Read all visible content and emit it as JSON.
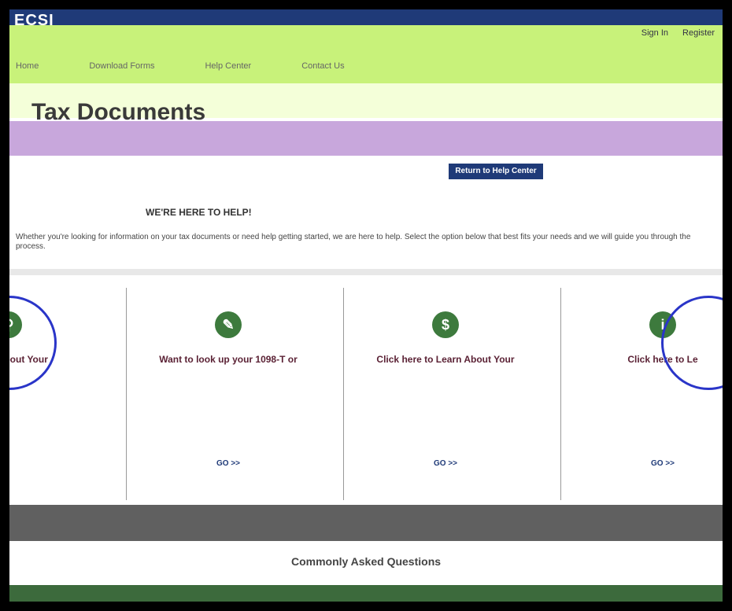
{
  "header": {
    "logo": "ECSI",
    "account": {
      "sign_in": "Sign In",
      "register": "Register"
    },
    "nav": [
      "Home",
      "Download Forms",
      "Help Center",
      "Contact Us"
    ]
  },
  "page": {
    "title": "Tax Documents",
    "return_button": "Return to Help Center",
    "section_title": "WE'RE HERE TO HELP!",
    "intro": "Whether you're looking for information on your tax documents or need help getting started, we are here to help. Select the option below that best fits your needs and we will guide you through the process."
  },
  "cards": [
    {
      "title": "Learn About Your",
      "desc": "",
      "go": "",
      "icon": "magnifier-icon"
    },
    {
      "title": "Want to look up your 1098-T or",
      "desc": "",
      "go": "GO >>",
      "icon": "pencil-icon"
    },
    {
      "title": "Click here to Learn About Your",
      "desc": "",
      "go": "GO >>",
      "icon": "dollar-icon"
    },
    {
      "title": "Click here to Le",
      "desc": "",
      "go": "GO >>",
      "icon": "info-icon"
    }
  ],
  "faq": "Commonly Asked Questions",
  "footer": {
    "left": "",
    "right": ""
  },
  "colors": {
    "brand_blue": "#1f3a78",
    "accent_green": "#3d7a3d",
    "card_title": "#5b2235"
  }
}
